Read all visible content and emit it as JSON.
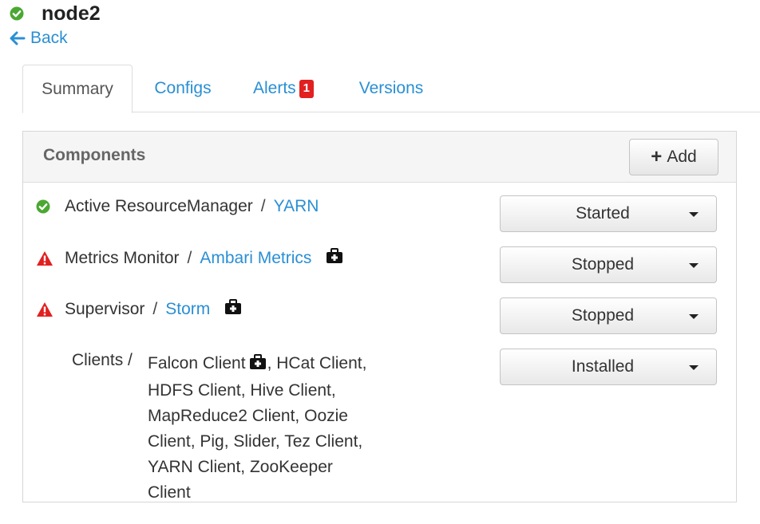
{
  "host": {
    "name": "node2",
    "status_color": "#4aa832"
  },
  "back": {
    "label": "Back"
  },
  "tabs": [
    {
      "label": "Summary",
      "active": true
    },
    {
      "label": "Configs",
      "active": false
    },
    {
      "label": "Alerts",
      "active": false,
      "badge": "1"
    },
    {
      "label": "Versions",
      "active": false
    }
  ],
  "components": {
    "title": "Components",
    "add_label": "Add",
    "rows": [
      {
        "status": "ok",
        "name": "Active ResourceManager",
        "separator": "/",
        "service": "YARN",
        "maintenance": false,
        "state": "Started"
      },
      {
        "status": "alert",
        "name": "Metrics Monitor",
        "separator": "/",
        "service": "Ambari Metrics",
        "maintenance": true,
        "state": "Stopped"
      },
      {
        "status": "alert",
        "name": "Supervisor",
        "separator": "/",
        "service": "Storm",
        "maintenance": true,
        "state": "Stopped"
      }
    ],
    "clients": {
      "label": "Clients /",
      "first": "Falcon Client",
      "rest": ", HCat Client, HDFS Client, Hive Client, MapReduce2 Client, Oozie Client, Pig, Slider, Tez Client, YARN Client, ZooKeeper Client",
      "state": "Installed"
    }
  },
  "colors": {
    "link": "#2a8fd4",
    "alert": "#e12020",
    "ok": "#4aa832"
  }
}
